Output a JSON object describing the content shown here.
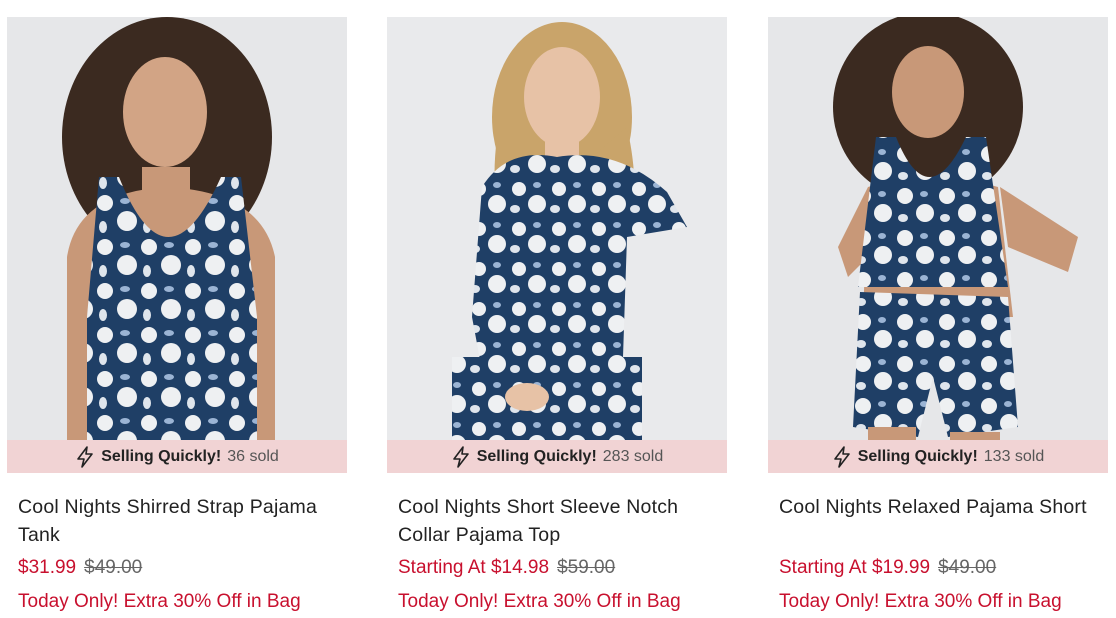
{
  "products": [
    {
      "image_alt": "Cool Nights Shirred Strap Pajama Tank",
      "badge": {
        "label": "Selling Quickly!",
        "sold": "36 sold",
        "icon": "lightning-bolt-icon"
      },
      "title": "Cool Nights Shirred Strap Pajama Tank",
      "price": "$31.99",
      "original_price": "$49.00",
      "promo": "Today Only! Extra 30% Off in Bag"
    },
    {
      "image_alt": "Cool Nights Short Sleeve Notch Collar Pajama Top",
      "badge": {
        "label": "Selling Quickly!",
        "sold": "283 sold",
        "icon": "lightning-bolt-icon"
      },
      "title": "Cool Nights Short Sleeve Notch Collar Pajama Top",
      "price": "Starting At $14.98",
      "original_price": "$59.00",
      "promo": "Today Only! Extra 30% Off in Bag"
    },
    {
      "image_alt": "Cool Nights Relaxed Pajama Short",
      "badge": {
        "label": "Selling Quickly!",
        "sold": "133 sold",
        "icon": "lightning-bolt-icon"
      },
      "title": "Cool Nights Relaxed Pajama Short",
      "price": "Starting At $19.99",
      "original_price": "$49.00",
      "promo": "Today Only! Extra 30% Off in Bag"
    }
  ],
  "colors": {
    "sale_red": "#c8102e",
    "badge_bg": "#f1d3d4",
    "photo_bg": "#e6e7e9",
    "print_navy": "#1f3f66"
  }
}
